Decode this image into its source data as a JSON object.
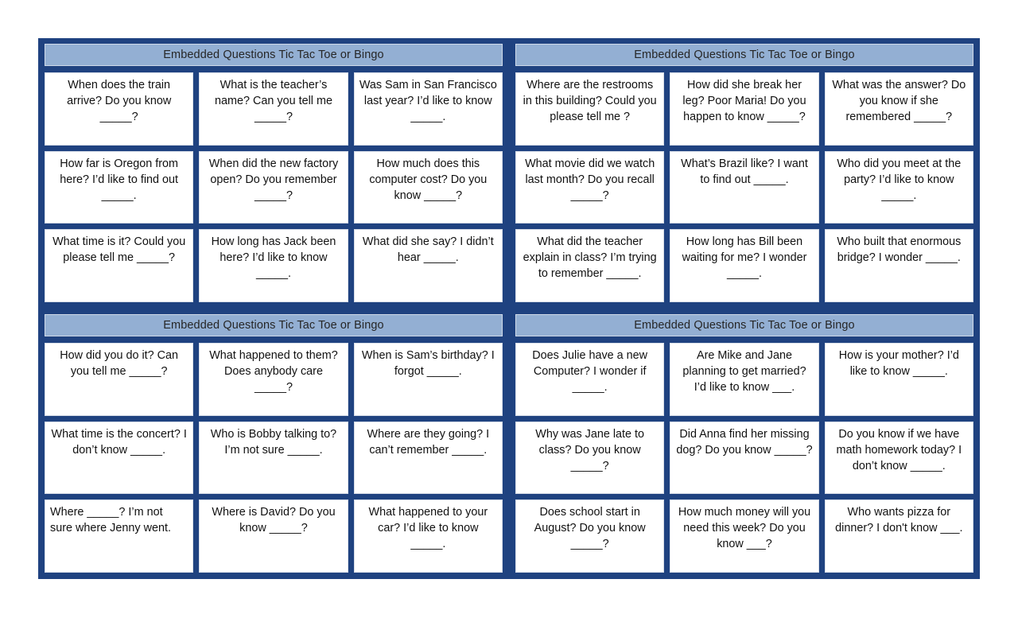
{
  "document": {
    "title": "Embedded Questions Tic Tac Toe or Bingo",
    "colors": {
      "frame_navy": "#1F4280",
      "title_bar_blue": "#93AFD3",
      "cell_background": "#FFFFFF",
      "text": "#111111",
      "page_background": "#FFFFFF"
    }
  },
  "boards": [
    {
      "id": "board-top-left",
      "title": "Embedded Questions Tic Tac Toe or Bingo",
      "rows": [
        {
          "cells": [
            {
              "text": "When does the train arrive?  Do you know _____?",
              "align": "center"
            },
            {
              "text": "What is the teacher’s name?  Can you tell me _____?",
              "align": "center"
            },
            {
              "text": "Was Sam in San Francisco last year?  I’d like to know _____.",
              "align": "center"
            }
          ]
        },
        {
          "cells": [
            {
              "text": "How far is Oregon from here?  I’d like to find out _____.",
              "align": "center"
            },
            {
              "text": "When did the new factory open?  Do you remember _____?",
              "align": "center"
            },
            {
              "text": "How much does this computer cost?  Do you know _____?",
              "align": "center"
            }
          ]
        },
        {
          "cells": [
            {
              "text": "What time is it?  Could you please tell me _____?",
              "align": "center"
            },
            {
              "text": "How long has Jack been here?  I’d like to know _____.",
              "align": "center"
            },
            {
              "text": "What did she say?  I didn’t hear _____.",
              "align": "center"
            }
          ]
        }
      ]
    },
    {
      "id": "board-top-right",
      "title": "Embedded Questions Tic Tac Toe or Bingo",
      "rows": [
        {
          "cells": [
            {
              "text": "Where are the restrooms in this building?  Could you please tell me         ?",
              "align": "center"
            },
            {
              "text": "How did she break her leg?  Poor Maria! Do you happen to know _____?",
              "align": "center"
            },
            {
              "text": "What was the answer?  Do you know if she remembered _____?",
              "align": "center"
            }
          ]
        },
        {
          "cells": [
            {
              "text": "What movie did we watch last month?  Do you recall _____?",
              "align": "center"
            },
            {
              "text": "What’s Brazil like?  I want to find out _____.",
              "align": "center"
            },
            {
              "text": "Who did you meet at the party?  I’d like to know _____.",
              "align": "center"
            }
          ]
        },
        {
          "cells": [
            {
              "text": "What did the teacher explain in class?  I’m trying to remember _____.",
              "align": "center"
            },
            {
              "text": "How long has Bill been waiting for me?  I wonder _____.",
              "align": "center"
            },
            {
              "text": "Who built that enormous bridge?  I wonder _____.",
              "align": "center"
            }
          ]
        }
      ]
    },
    {
      "id": "board-bottom-left",
      "title": "Embedded Questions Tic Tac Toe or Bingo",
      "rows": [
        {
          "cells": [
            {
              "text": "How did you do it?  Can you tell me _____?",
              "align": "center"
            },
            {
              "text": "What happened to them?  Does anybody care _____?",
              "align": "center"
            },
            {
              "text": "When is Sam’s birthday?  I forgot _____.",
              "align": "center"
            }
          ]
        },
        {
          "cells": [
            {
              "text": "What time is the concert?  I don’t know _____.",
              "align": "center"
            },
            {
              "text": "Who is Bobby talking to?  I’m not sure _____.",
              "align": "center"
            },
            {
              "text": "Where are they going?  I can’t remember _____.",
              "align": "center"
            }
          ]
        },
        {
          "cells": [
            {
              "text": "Where _____?  I’m not sure where Jenny went.",
              "align": "center"
            },
            {
              "text": "Where is David?  Do you know _____?",
              "align": "center"
            },
            {
              "text": "What happened to your car?  I’d like to know _____.",
              "align": "center"
            }
          ]
        }
      ]
    },
    {
      "id": "board-bottom-right",
      "title": "Embedded Questions Tic Tac Toe or Bingo",
      "rows": [
        {
          "cells": [
            {
              "text": "Does Julie have a new Computer?  I wonder if _____.",
              "align": "center"
            },
            {
              "text": "Are Mike and Jane planning to get married?  I’d like to know ___.",
              "align": "center"
            },
            {
              "text": "How is your mother? I’d like to know _____.",
              "align": "center"
            }
          ]
        },
        {
          "cells": [
            {
              "text": "Why was Jane late to class?  Do you know _____?",
              "align": "center"
            },
            {
              "text": "Did Anna find her missing dog?  Do you know _____?",
              "align": "center"
            },
            {
              "text": "Do you know if we have math homework today?  I don’t know _____.",
              "align": "center"
            }
          ]
        },
        {
          "cells": [
            {
              "text": "Does school start in August?  Do you know _____?",
              "align": "center"
            },
            {
              "text": "How much money will you need this week?  Do you know ___?",
              "align": "center"
            },
            {
              "text": "Who wants pizza for dinner?  I don't know ___.",
              "align": "center"
            }
          ]
        }
      ]
    }
  ]
}
